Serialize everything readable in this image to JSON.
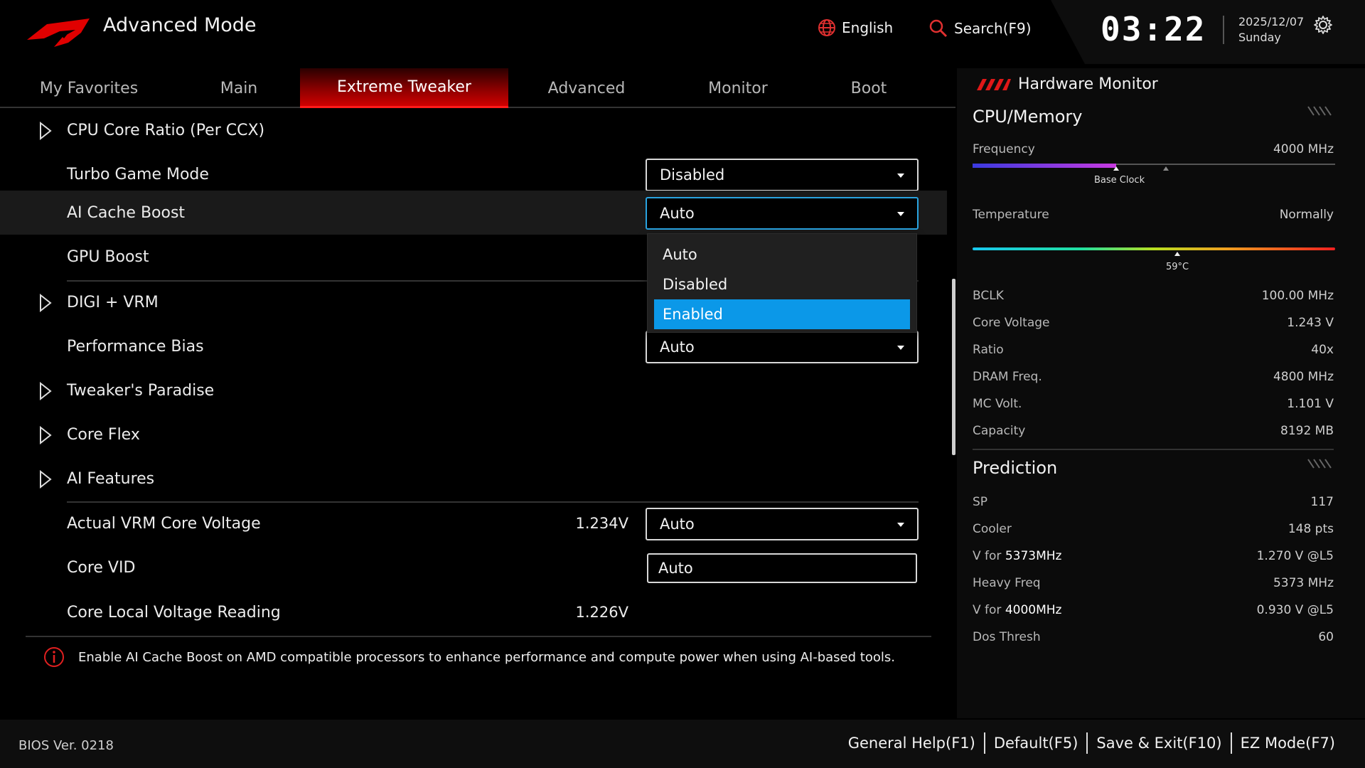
{
  "header": {
    "title": "Advanced Mode",
    "language": "English",
    "search": "Search(F9)",
    "time": "03:22",
    "date": "2025/12/07",
    "weekday": "Sunday",
    "icons": {
      "logo": "rog-logo",
      "language": "globe-icon",
      "search": "search-icon",
      "settings": "gear-icon"
    },
    "accent_color": "#d00000"
  },
  "tabs": [
    {
      "label": "My Favorites"
    },
    {
      "label": "Main"
    },
    {
      "label": "Extreme Tweaker",
      "active": true
    },
    {
      "label": "Advanced"
    },
    {
      "label": "Monitor"
    },
    {
      "label": "Boot"
    }
  ],
  "settings": {
    "cpu_core_ratio": {
      "label": "CPU Core Ratio (Per CCX)"
    },
    "turbo_game_mode": {
      "label": "Turbo Game Mode",
      "value": "Disabled"
    },
    "ai_cache_boost": {
      "label": "AI Cache Boost",
      "value": "Auto"
    },
    "gpu_boost": {
      "label": "GPU Boost"
    },
    "digi_vrm": {
      "label": "DIGI + VRM"
    },
    "performance_bias": {
      "label": "Performance Bias",
      "value": "Auto"
    },
    "tweakers_paradise": {
      "label": "Tweaker's Paradise"
    },
    "core_flex": {
      "label": "Core Flex"
    },
    "ai_features": {
      "label": "AI Features"
    },
    "actual_vrm_core_voltage": {
      "label": "Actual VRM Core Voltage",
      "reading": "1.234V",
      "value": "Auto"
    },
    "core_vid": {
      "label": "Core VID",
      "value": "Auto"
    },
    "core_local_voltage": {
      "label": "Core Local Voltage Reading",
      "reading": "1.226V"
    }
  },
  "dropdown": {
    "options": [
      "Auto",
      "Disabled",
      "Enabled"
    ],
    "highlighted": "Enabled",
    "highlight_color": "#0b98e8"
  },
  "help": {
    "text": "Enable AI Cache Boost on AMD compatible processors to enhance performance and compute power when using AI-based tools."
  },
  "hardware_monitor": {
    "title": "Hardware Monitor",
    "cpu_memory": {
      "title": "CPU/Memory",
      "frequency_label": "Frequency",
      "frequency_value": "4000 MHz",
      "base_clock_label": "Base Clock",
      "temperature_label": "Temperature",
      "temperature_value": "Normally",
      "temperature_marker": "59°C",
      "items": [
        {
          "label": "BCLK",
          "value": "100.00 MHz"
        },
        {
          "label": "Core Voltage",
          "value": "1.243 V"
        },
        {
          "label": "Ratio",
          "value": "40x"
        },
        {
          "label": "DRAM Freq.",
          "value": "4800 MHz"
        },
        {
          "label": "MC Volt.",
          "value": "1.101 V"
        },
        {
          "label": "Capacity",
          "value": "8192 MB"
        }
      ]
    },
    "prediction": {
      "title": "Prediction",
      "items": [
        {
          "label": "SP",
          "value": "117"
        },
        {
          "label": "Cooler",
          "value": "148 pts"
        },
        {
          "label_prefix": "V for ",
          "label_strong": "5373MHz",
          "value": "1.270 V @L5"
        },
        {
          "label": "Heavy Freq",
          "value": "5373 MHz"
        },
        {
          "label_prefix": "V for ",
          "label_strong": "4000MHz",
          "value": "0.930 V @L5"
        },
        {
          "label": "Dos Thresh",
          "value": "60"
        }
      ]
    }
  },
  "footer": {
    "bios_version": "BIOS Ver. 0218",
    "keys": [
      "General Help(F1)",
      "Default(F5)",
      "Save & Exit(F10)",
      "EZ Mode(F7)"
    ]
  }
}
